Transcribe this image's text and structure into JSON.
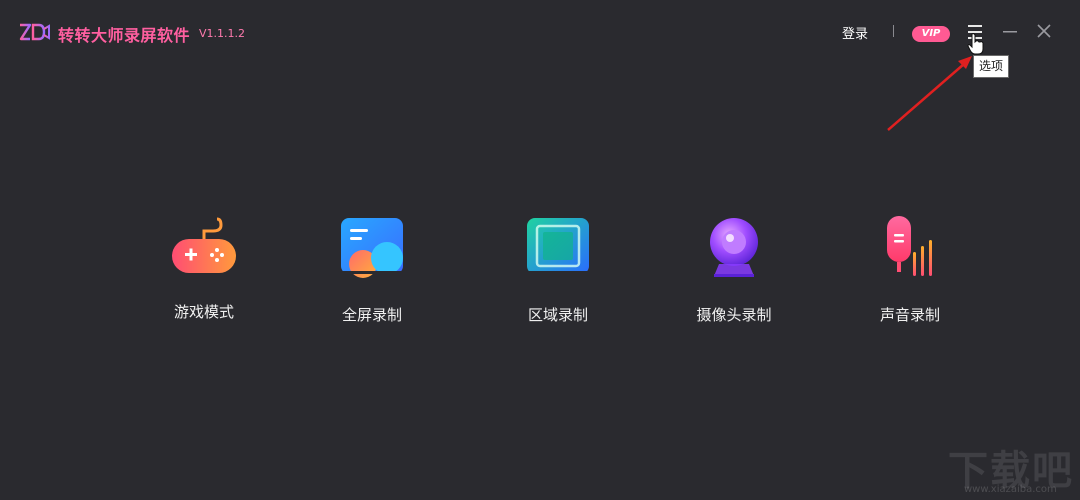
{
  "app": {
    "title": "转转大师录屏软件",
    "version": "V1.1.1.2",
    "logo_icon": "zzds-logo-icon",
    "accent_color": "#ff5a93",
    "background_color": "#2a2a2f"
  },
  "header": {
    "login_label": "登录",
    "vip_label": "VIP",
    "menu_icon": "hamburger-menu-icon",
    "minimize_icon": "minimize-icon",
    "close_icon": "close-icon",
    "tooltip": "选项"
  },
  "modes": [
    {
      "label": "游戏模式",
      "icon": "gamepad-icon"
    },
    {
      "label": "全屏录制",
      "icon": "fullscreen-record-icon"
    },
    {
      "label": "区域录制",
      "icon": "region-record-icon"
    },
    {
      "label": "摄像头录制",
      "icon": "webcam-icon"
    },
    {
      "label": "声音录制",
      "icon": "microphone-icon"
    }
  ],
  "annotation": {
    "arrow_color": "#e02020"
  },
  "watermark": {
    "text": "下载吧",
    "url": "www.xiazaiba.com"
  }
}
